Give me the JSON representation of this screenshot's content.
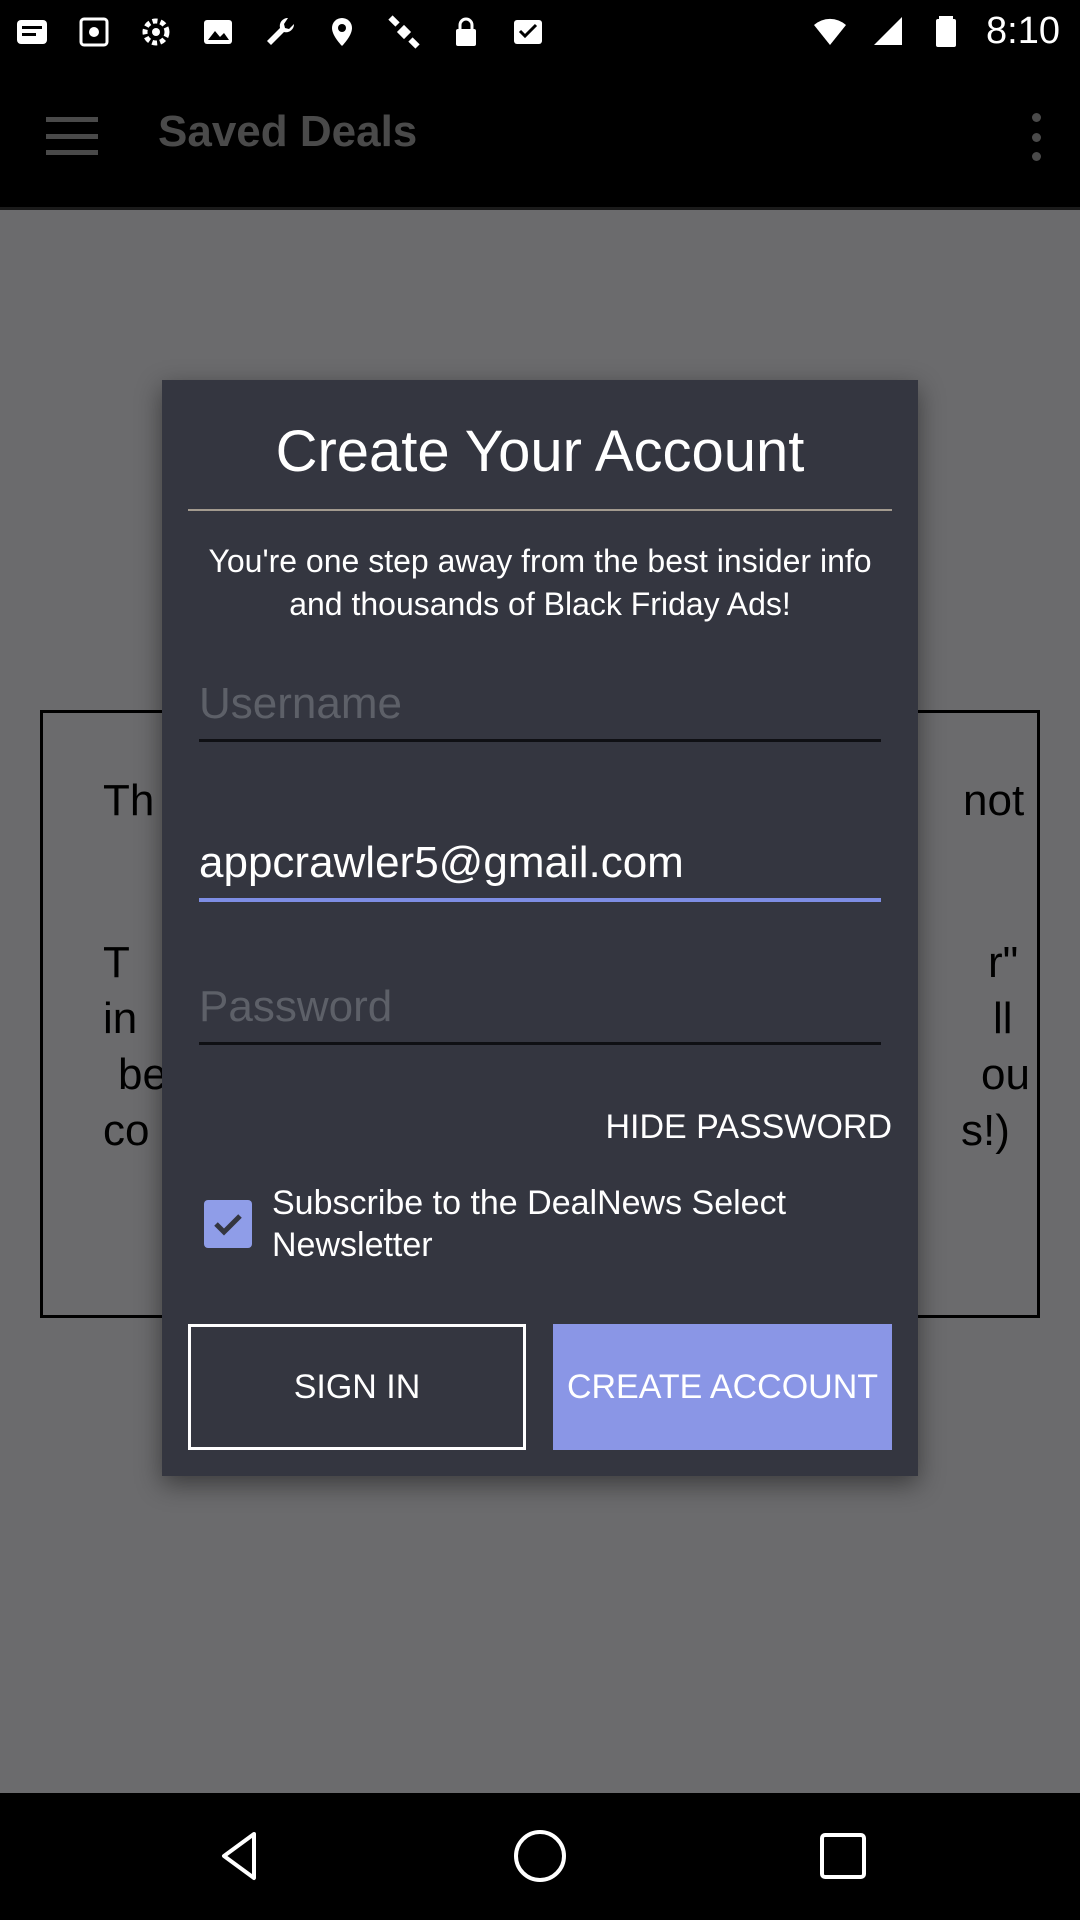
{
  "status_bar": {
    "time": "8:10",
    "left_icons": [
      "notification-icon",
      "screenshot-icon",
      "settings-icon",
      "photo-icon",
      "wrench-icon",
      "fake-gps-icon",
      "satellite-icon",
      "lock-icon",
      "inbox-check-icon"
    ],
    "right_icons": [
      "wifi-icon",
      "signal-icon",
      "battery-icon"
    ]
  },
  "app_bar": {
    "title": "Saved Deals"
  },
  "background_card": {
    "fragments": [
      "Th",
      "not",
      "T",
      "r\"",
      "in",
      "ll",
      "be",
      "ou",
      "co",
      "s!)"
    ]
  },
  "dialog": {
    "title": "Create Your Account",
    "subtitle": "You're one step away from the best insider info and thousands of Black Friday Ads!",
    "username": {
      "placeholder": "Username",
      "value": ""
    },
    "email": {
      "value": "appcrawler5@gmail.com"
    },
    "password": {
      "placeholder": "Password",
      "value": ""
    },
    "hide_password_label": "HIDE PASSWORD",
    "newsletter": {
      "label": "Subscribe to the DealNews Select Newsletter",
      "checked": true
    },
    "sign_in_label": "SIGN IN",
    "create_account_label": "CREATE ACCOUNT",
    "accent_color": "#8a96e6"
  },
  "nav_bar": {
    "buttons": [
      "back-icon",
      "home-icon",
      "recents-icon"
    ]
  }
}
